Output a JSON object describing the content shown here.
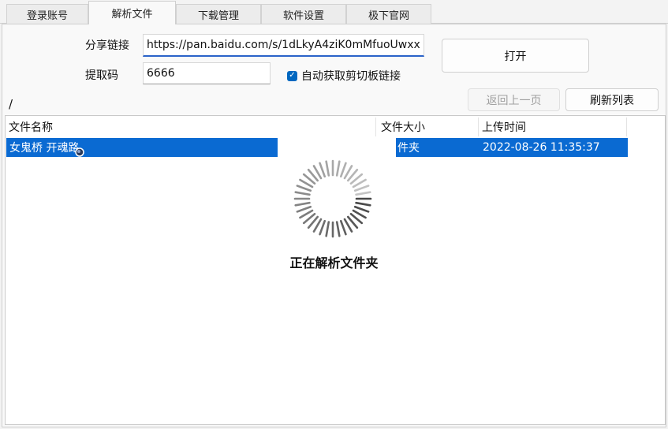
{
  "tabs": [
    {
      "label": "登录账号"
    },
    {
      "label": "解析文件"
    },
    {
      "label": "下载管理"
    },
    {
      "label": "软件设置"
    },
    {
      "label": "极下官网"
    }
  ],
  "form": {
    "share_link_label": "分享链接",
    "share_link_value": "https://pan.baidu.com/s/1dLkyA4ziK0mMfuoUwxx",
    "extract_code_label": "提取码",
    "extract_code_value": "6666",
    "auto_clipboard_label": "自动获取剪切板链接",
    "auto_clipboard_checked": true,
    "open_button": "打开"
  },
  "nav": {
    "path": "/",
    "back_button": "返回上一页",
    "refresh_button": "刷新列表"
  },
  "file_list": {
    "columns": [
      "文件名称",
      "文件大小",
      "上传时间"
    ],
    "rows": [
      {
        "name": "女鬼桥 开魂路",
        "size": "件夹",
        "time": "2022-08-26 11:35:37"
      }
    ]
  },
  "overlay": {
    "message": "正在解析文件夹",
    "icon": "loading-spinner-icon"
  },
  "colors": {
    "selection": "#0a6ad2",
    "accent": "#0067c0"
  }
}
